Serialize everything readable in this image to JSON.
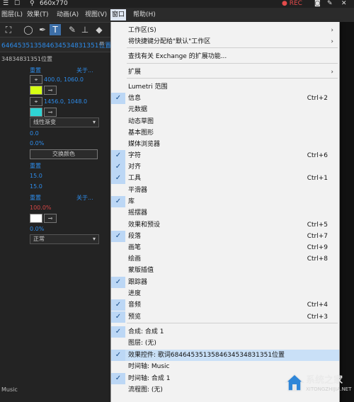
{
  "window": {
    "dims": "660x770",
    "rec": "REC"
  },
  "menubar": {
    "items": [
      {
        "label": "图层(L)",
        "active": false
      },
      {
        "label": "效果(T)",
        "active": false
      },
      {
        "label": "动画(A)",
        "active": false
      },
      {
        "label": "视图(V)",
        "active": false
      },
      {
        "label": "窗口",
        "active": true
      },
      {
        "label": "帮助(H)",
        "active": false
      }
    ]
  },
  "toolbar": {
    "icons": [
      "selection-icon",
      "ellipse-icon",
      "pen-icon",
      "type-icon",
      "brush-icon",
      "stamp-icon",
      "eraser-icon"
    ]
  },
  "panel": {
    "title": "64645351358463453483​1351位置",
    "subtitle": "34834831351位置",
    "reset1": "重置",
    "about1": "关于...",
    "pos1": "400.0, 1060.0",
    "pos2": "1456.0, 1048.0",
    "gradient": "线性渐变",
    "val1": "0.0",
    "val2": "0.0%",
    "swap": "交换颜色",
    "reset2": "重置",
    "val3": "15.0",
    "val4": "15.0",
    "reset3": "重置",
    "about3": "关于...",
    "pct": "100.0%",
    "val5": "0.0%",
    "blend": "正常",
    "footer": "Music"
  },
  "menu": {
    "items": [
      {
        "label": "工作区(S)",
        "shortcut": "",
        "checked": false,
        "submenu": true
      },
      {
        "label": "将快捷键分配给\"默认\"工作区",
        "shortcut": "",
        "checked": false,
        "submenu": true
      },
      {
        "label": "查找有关 Exchange 的扩展功能...",
        "shortcut": "",
        "checked": false,
        "submenu": false
      },
      {
        "label": "扩展",
        "shortcut": "",
        "checked": false,
        "submenu": true
      },
      {
        "label": "Lumetri 范围",
        "shortcut": "",
        "checked": false,
        "submenu": false
      },
      {
        "label": "信息",
        "shortcut": "Ctrl+2",
        "checked": true,
        "submenu": false
      },
      {
        "label": "元数据",
        "shortcut": "",
        "checked": false,
        "submenu": false
      },
      {
        "label": "动态草图",
        "shortcut": "",
        "checked": false,
        "submenu": false
      },
      {
        "label": "基本图形",
        "shortcut": "",
        "checked": false,
        "submenu": false
      },
      {
        "label": "媒体浏览器",
        "shortcut": "",
        "checked": false,
        "submenu": false
      },
      {
        "label": "字符",
        "shortcut": "Ctrl+6",
        "checked": true,
        "submenu": false
      },
      {
        "label": "对齐",
        "shortcut": "",
        "checked": true,
        "submenu": false
      },
      {
        "label": "工具",
        "shortcut": "Ctrl+1",
        "checked": true,
        "submenu": false
      },
      {
        "label": "平滑器",
        "shortcut": "",
        "checked": false,
        "submenu": false
      },
      {
        "label": "库",
        "shortcut": "",
        "checked": true,
        "submenu": false
      },
      {
        "label": "摇摆器",
        "shortcut": "",
        "checked": false,
        "submenu": false
      },
      {
        "label": "效果和预设",
        "shortcut": "Ctrl+5",
        "checked": false,
        "submenu": false
      },
      {
        "label": "段落",
        "shortcut": "Ctrl+7",
        "checked": true,
        "submenu": false
      },
      {
        "label": "画笔",
        "shortcut": "Ctrl+9",
        "checked": false,
        "submenu": false
      },
      {
        "label": "绘画",
        "shortcut": "Ctrl+8",
        "checked": false,
        "submenu": false
      },
      {
        "label": "蒙版插值",
        "shortcut": "",
        "checked": false,
        "submenu": false
      },
      {
        "label": "跟踪器",
        "shortcut": "",
        "checked": true,
        "submenu": false
      },
      {
        "label": "进度",
        "shortcut": "",
        "checked": false,
        "submenu": false
      },
      {
        "label": "音频",
        "shortcut": "Ctrl+4",
        "checked": true,
        "submenu": false
      },
      {
        "label": "预览",
        "shortcut": "Ctrl+3",
        "checked": true,
        "submenu": false
      },
      {
        "label": "合成: 合成 1",
        "shortcut": "",
        "checked": true,
        "submenu": false
      },
      {
        "label": "图层: (无)",
        "shortcut": "",
        "checked": false,
        "submenu": false
      },
      {
        "label": "效果控件: 歌词6846453513584634534831351位置",
        "shortcut": "",
        "checked": true,
        "submenu": false,
        "highlighted": true
      },
      {
        "label": "时间轴: Music",
        "shortcut": "",
        "checked": false,
        "submenu": false
      },
      {
        "label": "时间轴: 合成 1",
        "shortcut": "",
        "checked": true,
        "submenu": false
      },
      {
        "label": "流程图: (无)",
        "shortcut": "",
        "checked": false,
        "submenu": false
      }
    ]
  },
  "watermark": {
    "title": "系统之家",
    "url": "XITONGZHIJIA.NET"
  },
  "colors": {
    "menu_bg": "#f2f2f2",
    "check_bg": "#bcd7f5",
    "highlight": "#c9e0f7",
    "accent_blue": "#2d8ceb",
    "swatch_yellow": "#d6ff14",
    "swatch_cyan": "#2fd3d3",
    "swatch_white": "#ffffff"
  }
}
